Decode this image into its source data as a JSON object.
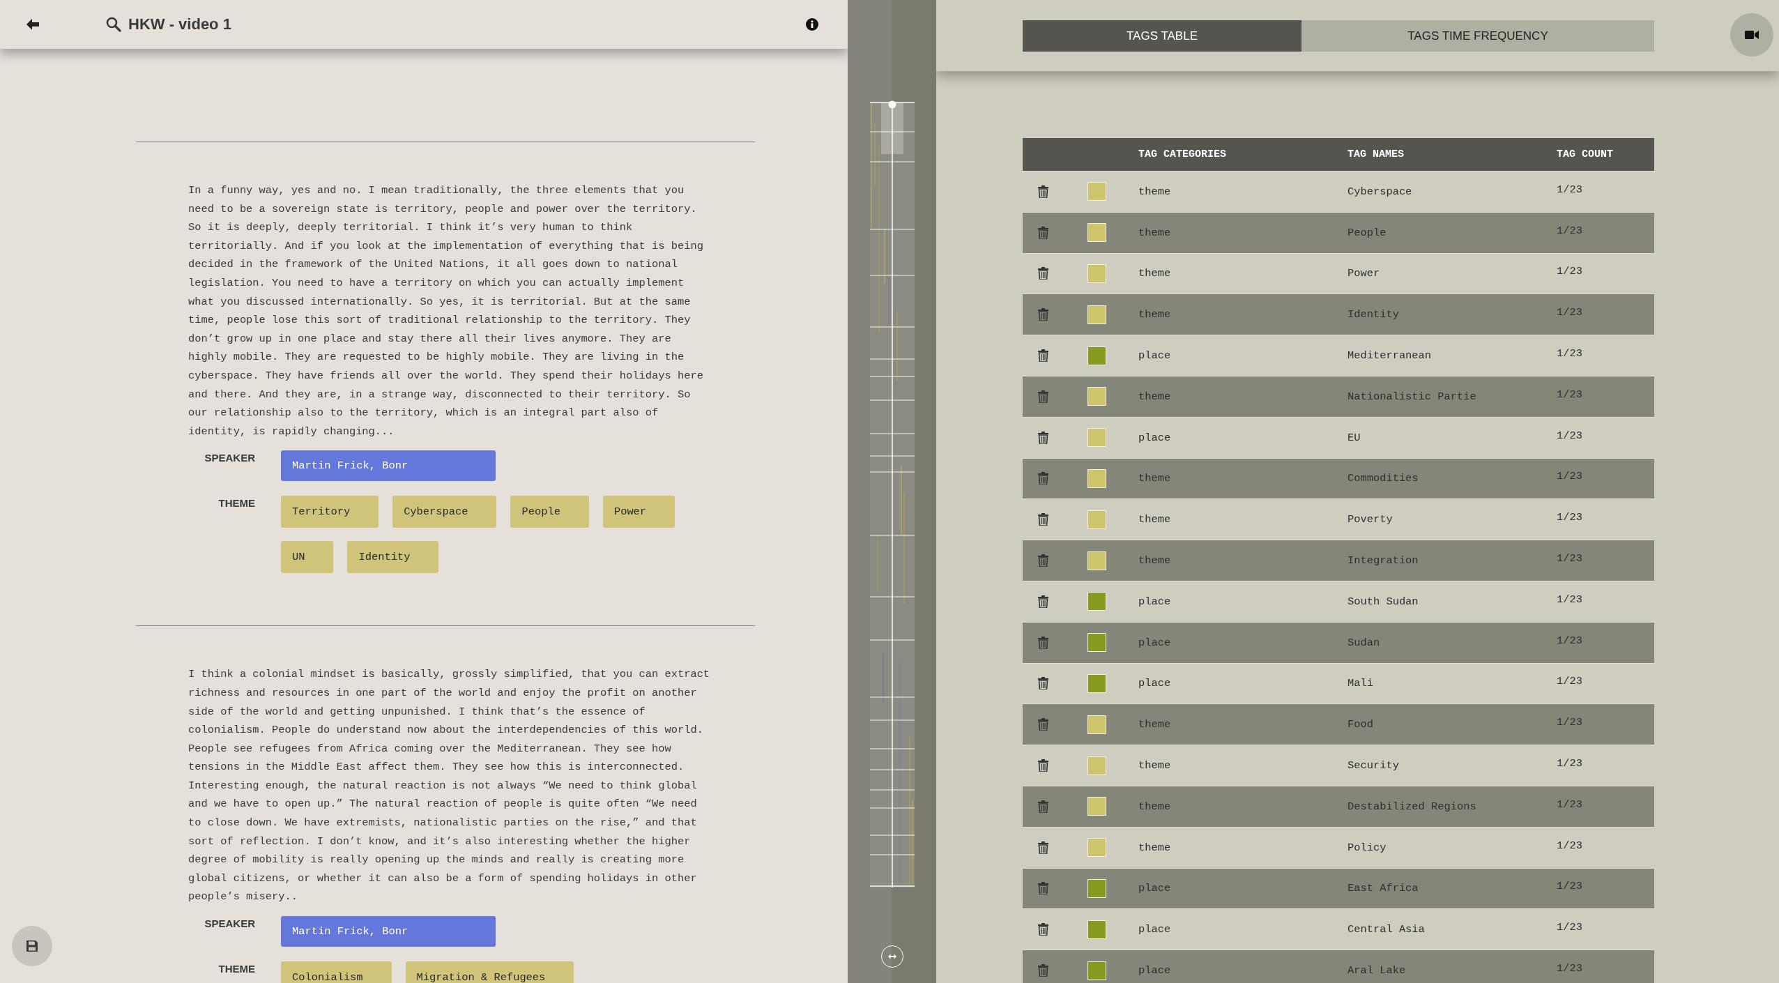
{
  "header": {
    "title": "HKW - video 1"
  },
  "segments": [
    {
      "text": "In a funny way, yes and no. I mean traditionally, the three elements that you need to be a sovereign state is territory, people and power over the territory. So it is deeply, deeply territorial. I think it’s very human to think territorially. And if you look at the implementation of everything that is being decided in the framework of the United Nations, it all goes down to national legislation. You need to have a territory on which you can actually implement what you discussed internationally. So yes, it is territorial. But at the same time, people lose this sort of traditional relationship to the territory. They don’t grow up in one place and stay there all their lives anymore. They are highly mobile. They are requested to be highly mobile. They are living in the cyberspace. They have friends all over the world. They spend their holidays here and there. And they are, in a strange way, disconnected to their territory. So our relationship also to the territory, which is an integral part also of identity, is rapidly changing...",
      "speaker_label": "SPEAKER",
      "speaker": "Martin Frick, Bonr",
      "theme_label": "THEME",
      "themes": [
        "Territory",
        "Cyberspace",
        "People",
        "Power",
        "UN",
        "Identity"
      ]
    },
    {
      "text": "I think a colonial mindset is basically, grossly simplified, that you can extract richness and resources in one part of the world and enjoy the profit on another side of the world and getting unpunished. I think that’s the essence of colonialism. People do understand now about the interdependencies of this world. People see refugees from Africa coming over the Mediterranean. They see how tensions in the Middle East affect them. They see how this is interconnected. Interesting enough, the natural reaction is not always “We need to think global and we have to open up.” The natural reaction of people is quite often “We need to close down. We have extremists, nationalistic parties on the rise,” and that sort of reflection. I don’t know, and it’s also interesting whether the higher degree of mobility is really opening up the minds and really is creating more global citizens, or whether it can also be a form of spending holidays in other people’s misery..",
      "speaker_label": "SPEAKER",
      "speaker": "Martin Frick, Bonr",
      "theme_label": "THEME",
      "themes": [
        "Colonialism",
        "Migration & Refugees"
      ]
    }
  ],
  "timeline": {
    "level": 0
  },
  "tabs": [
    {
      "label": "TAGS TABLE",
      "selected": true
    },
    {
      "label": "TAGS TIME FREQUENCY",
      "selected": false
    }
  ],
  "tag_table": {
    "columns": [
      "TAG CATEGORIES",
      "TAG NAMES",
      "TAG COUNT"
    ],
    "rows": [
      {
        "category": "theme",
        "color": "#cdc46c",
        "name": "Cyberspace",
        "count": "1/23"
      },
      {
        "category": "theme",
        "color": "#cdc46c",
        "name": "People",
        "count": "1/23"
      },
      {
        "category": "theme",
        "color": "#cdc46c",
        "name": "Power",
        "count": "1/23"
      },
      {
        "category": "theme",
        "color": "#cdc46c",
        "name": "Identity",
        "count": "1/23"
      },
      {
        "category": "place",
        "color": "#859a1e",
        "name": "Mediterranean",
        "count": "1/23"
      },
      {
        "category": "theme",
        "color": "#cdc46c",
        "name": "Nationalistic Partie",
        "count": "1/23"
      },
      {
        "category": "place",
        "color": "#cdc46c",
        "name": "EU",
        "count": "1/23"
      },
      {
        "category": "theme",
        "color": "#cdc46c",
        "name": "Commodities",
        "count": "1/23"
      },
      {
        "category": "theme",
        "color": "#cdc46c",
        "name": "Poverty",
        "count": "1/23"
      },
      {
        "category": "theme",
        "color": "#cdc46c",
        "name": "Integration",
        "count": "1/23"
      },
      {
        "category": "place",
        "color": "#859a1e",
        "name": "South Sudan",
        "count": "1/23"
      },
      {
        "category": "place",
        "color": "#859a1e",
        "name": "Sudan",
        "count": "1/23"
      },
      {
        "category": "place",
        "color": "#859a1e",
        "name": "Mali",
        "count": "1/23"
      },
      {
        "category": "theme",
        "color": "#cdc46c",
        "name": "Food",
        "count": "1/23"
      },
      {
        "category": "theme",
        "color": "#cdc46c",
        "name": "Security",
        "count": "1/23"
      },
      {
        "category": "theme",
        "color": "#cdc46c",
        "name": "Destabilized Regions",
        "count": "1/23"
      },
      {
        "category": "theme",
        "color": "#cdc46c",
        "name": "Policy",
        "count": "1/23"
      },
      {
        "category": "place",
        "color": "#859a1e",
        "name": "East Africa",
        "count": "1/23"
      },
      {
        "category": "place",
        "color": "#859a1e",
        "name": "Central Asia",
        "count": "1/23"
      },
      {
        "category": "place",
        "color": "#859a1e",
        "name": "Aral Lake",
        "count": "1/23"
      }
    ]
  }
}
